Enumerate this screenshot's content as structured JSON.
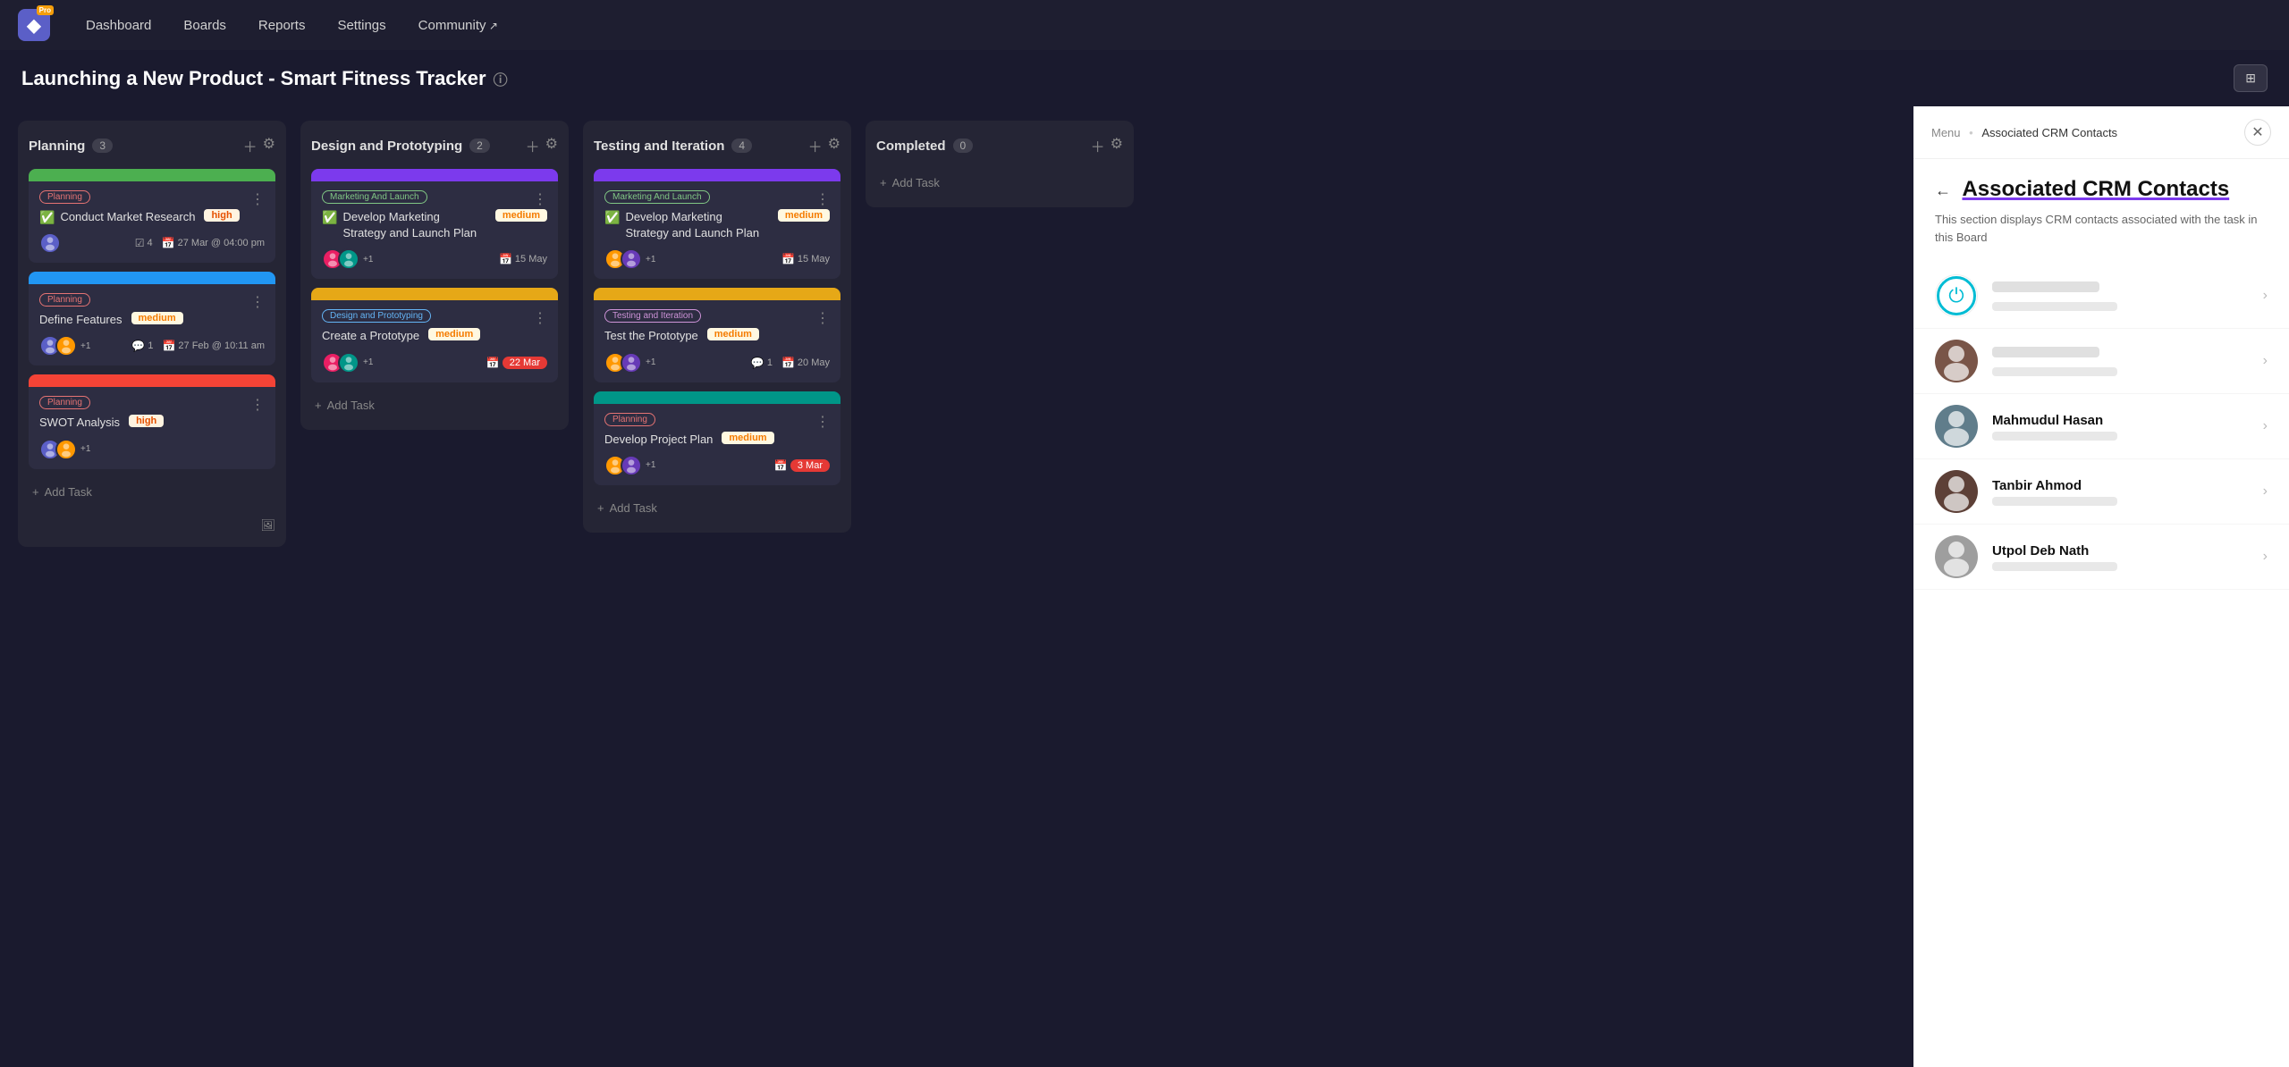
{
  "app": {
    "logo": "◆",
    "pro_badge": "Pro",
    "nav": [
      "Dashboard",
      "Boards",
      "Reports",
      "Settings",
      "Community ↗"
    ]
  },
  "page": {
    "title": "Launching a New Product - Smart Fitness Tracker",
    "toolbar_icon": "⊞"
  },
  "columns": [
    {
      "id": "planning",
      "title": "Planning",
      "count": "3",
      "cards": [
        {
          "banner_color": "#4caf50",
          "tag": "Planning",
          "tag_class": "planning",
          "has_check": true,
          "title": "Conduct Market Research",
          "priority": "high",
          "priority_class": "priority-high",
          "avatars": 1,
          "comments": null,
          "tasks": "4",
          "date": "27 Mar @ 04:00 pm",
          "date_overdue": false
        },
        {
          "banner_color": "#2196f3",
          "tag": "Planning",
          "tag_class": "planning",
          "has_check": false,
          "title": "Define Features",
          "priority": "medium",
          "priority_class": "priority-medium",
          "avatars": 2,
          "comments": "1",
          "tasks": null,
          "date": "27 Feb @ 10:11 am",
          "date_overdue": false
        },
        {
          "banner_color": "#f44336",
          "tag": "Planning",
          "tag_class": "planning",
          "has_check": false,
          "title": "SWOT Analysis",
          "priority": "high",
          "priority_class": "priority-high",
          "avatars": 2,
          "comments": null,
          "tasks": null,
          "date": null,
          "date_overdue": false
        }
      ]
    },
    {
      "id": "design",
      "title": "Design and Prototyping",
      "count": "2",
      "cards": [
        {
          "banner_color": "#7c3aed",
          "tag": "Marketing And Launch",
          "tag_class": "marketing",
          "has_check": true,
          "title": "Develop Marketing Strategy and Launch Plan",
          "priority": "medium",
          "priority_class": "priority-medium",
          "avatars": 2,
          "comments": null,
          "tasks": null,
          "date": "15 May",
          "date_overdue": false
        },
        {
          "banner_color": "#e6a817",
          "tag": "Design and Prototyping",
          "tag_class": "design",
          "has_check": false,
          "title": "Create a Prototype",
          "priority": "medium",
          "priority_class": "priority-medium",
          "avatars": 2,
          "comments": null,
          "tasks": null,
          "date": "22 Mar",
          "date_overdue": true
        }
      ]
    },
    {
      "id": "testing",
      "title": "Testing and Iteration",
      "count": "4",
      "cards": [
        {
          "banner_color": "#7c3aed",
          "tag": "Marketing And Launch",
          "tag_class": "marketing",
          "has_check": true,
          "title": "Develop Marketing Strategy and Launch Plan",
          "priority": "medium",
          "priority_class": "priority-medium",
          "avatars": 2,
          "comments": null,
          "tasks": null,
          "date": "15 May",
          "date_overdue": false
        },
        {
          "banner_color": "#e6a817",
          "tag": "Testing and Iteration",
          "tag_class": "testing",
          "has_check": false,
          "title": "Test the Prototype",
          "priority": "medium",
          "priority_class": "priority-medium",
          "avatars": 2,
          "comments": "1",
          "tasks": null,
          "date": "20 May",
          "date_overdue": false
        },
        {
          "banner_color": "#009688",
          "tag": "Planning",
          "tag_class": "planning",
          "has_check": false,
          "title": "Develop Project Plan",
          "priority": "medium",
          "priority_class": "priority-medium",
          "avatars": 2,
          "comments": null,
          "tasks": null,
          "date": "3 Mar",
          "date_overdue": true
        }
      ]
    },
    {
      "id": "completed",
      "title": "Completed",
      "count": "0",
      "cards": []
    }
  ],
  "side_panel": {
    "breadcrumb_menu": "Menu",
    "breadcrumb_sep": "•",
    "breadcrumb_current": "Associated CRM Contacts",
    "title": "Associated CRM Contacts",
    "subtitle": "This section displays CRM contacts associated with the task in this Board",
    "contacts": [
      {
        "id": "contact-1",
        "name": "",
        "is_logo": true,
        "detail": ""
      },
      {
        "id": "contact-2",
        "name": "",
        "is_logo": false,
        "detail": ""
      },
      {
        "id": "contact-3",
        "name": "Mahmudul Hasan",
        "is_logo": false,
        "detail": ""
      },
      {
        "id": "contact-4",
        "name": "Tanbir Ahmod",
        "is_logo": false,
        "detail": ""
      },
      {
        "id": "contact-5",
        "name": "Utpol Deb Nath",
        "is_logo": false,
        "detail": ""
      }
    ]
  },
  "labels": {
    "add_task": "+ Add Task",
    "planning_tag": "Planning",
    "high": "high",
    "medium": "medium"
  }
}
